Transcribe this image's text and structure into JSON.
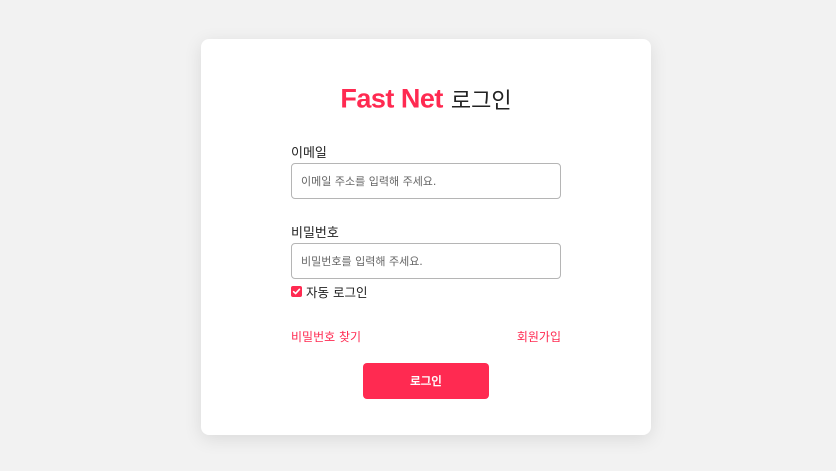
{
  "colors": {
    "accent": "#ff2a51",
    "background": "#f2f2f2",
    "card": "#ffffff",
    "text": "#222222",
    "input_border": "#b5b5b5"
  },
  "login": {
    "brand": "Fast Net",
    "title_suffix": "로그인",
    "email": {
      "label": "이메일",
      "value": "",
      "placeholder": "이메일 주소를 입력해 주세요."
    },
    "password": {
      "label": "비밀번호",
      "value": "",
      "placeholder": "비밀번호를 입력해 주세요."
    },
    "auto_login": {
      "label": "자동 로그인",
      "checked": true,
      "icon": "checkbox-checked-icon"
    },
    "find_password_link": "비밀번호 찾기",
    "signup_link": "회원가입",
    "submit_label": "로그인"
  }
}
